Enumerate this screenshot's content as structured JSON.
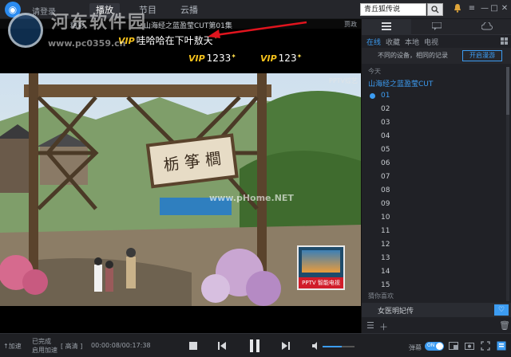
{
  "header": {
    "login_label": "请登录",
    "tabs": [
      {
        "label": "播放",
        "active": true
      },
      {
        "label": "节目",
        "active": false
      },
      {
        "label": "云播",
        "active": false
      }
    ],
    "search_value": "青丘狐传说"
  },
  "watermark": {
    "site_name": "河东软件园",
    "site_url": "www.pc0359.cn",
    "center_watermark": "www.pHome.NET"
  },
  "video": {
    "title_prefix": "精彩",
    "title": "山海经之蓝盈莹CUT第01集",
    "corner_label": "贾政",
    "channel_badge": "PPTV综艺",
    "tv_ad_label": "PPTV 智能电视",
    "danmu": [
      {
        "vip": "VIP",
        "text": "哇哈哈在下叶敖天"
      },
      {
        "vip": "VIP",
        "text": "1233"
      },
      {
        "vip": "VIP",
        "text": "123"
      }
    ],
    "bullet_toggle_label": "弹"
  },
  "panel": {
    "sub_tabs": [
      {
        "label": "在线",
        "active": true
      },
      {
        "label": "收藏",
        "active": false
      },
      {
        "label": "本地",
        "active": false
      },
      {
        "label": "电视",
        "active": false
      }
    ],
    "sync_text": "不同的设备，相同的记录",
    "sync_button": "开启漫游",
    "today_label": "今天",
    "show_title": "山海经之蓝盈莹CUT",
    "episodes": [
      "01",
      "02",
      "03",
      "04",
      "05",
      "06",
      "07",
      "08",
      "09",
      "10",
      "11",
      "12",
      "13",
      "14",
      "15"
    ],
    "active_episode": "01",
    "guess_label": "猜你喜欢",
    "recommend_title": "女医明妃传"
  },
  "controls": {
    "accel_label": "加速",
    "status_line1": "已完成",
    "status_line2": "启用加速",
    "quality_label": "高清",
    "time_text": "00:00:08/00:17:38",
    "danmu_label": "弹幕",
    "toggle_text": "ON"
  },
  "colors": {
    "accent": "#3c9cf2",
    "vip": "#f5c11b",
    "panel_bg": "#202126",
    "tv_red": "#d11d2a"
  }
}
